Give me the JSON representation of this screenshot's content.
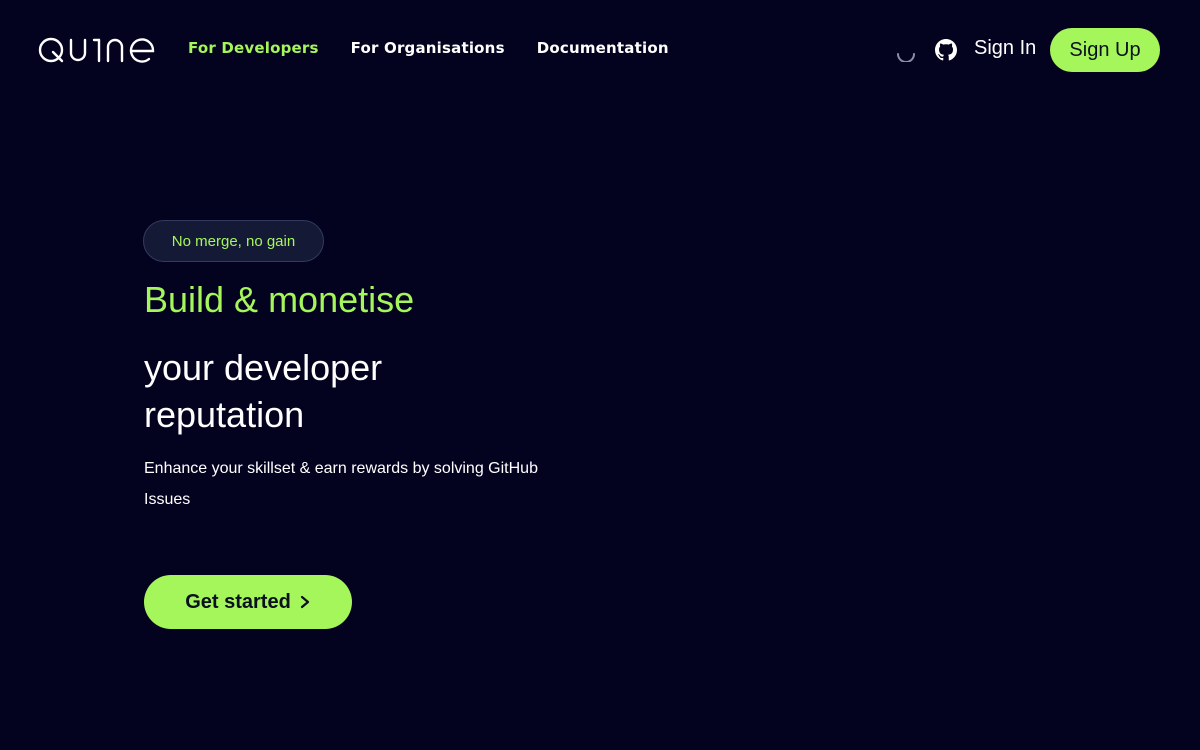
{
  "brand": {
    "name": "QUINE",
    "accent": "#a4f65a",
    "background": "#03021f"
  },
  "nav": {
    "items": [
      {
        "label": "For Developers",
        "active": true
      },
      {
        "label": "For Organisations",
        "active": false
      },
      {
        "label": "Documentation",
        "active": false
      }
    ]
  },
  "header": {
    "loading_icon": "spinner-icon",
    "github_icon": "github-icon",
    "sign_in_label": "Sign In",
    "sign_up_label": "Sign Up"
  },
  "hero": {
    "badge": "No merge, no gain",
    "title": "Build & monetise",
    "subtitle": "your developer reputation",
    "description": "Enhance your skillset & earn rewards by solving GitHub Issues",
    "cta_label": "Get started",
    "cta_icon": "chevron-right-icon"
  }
}
